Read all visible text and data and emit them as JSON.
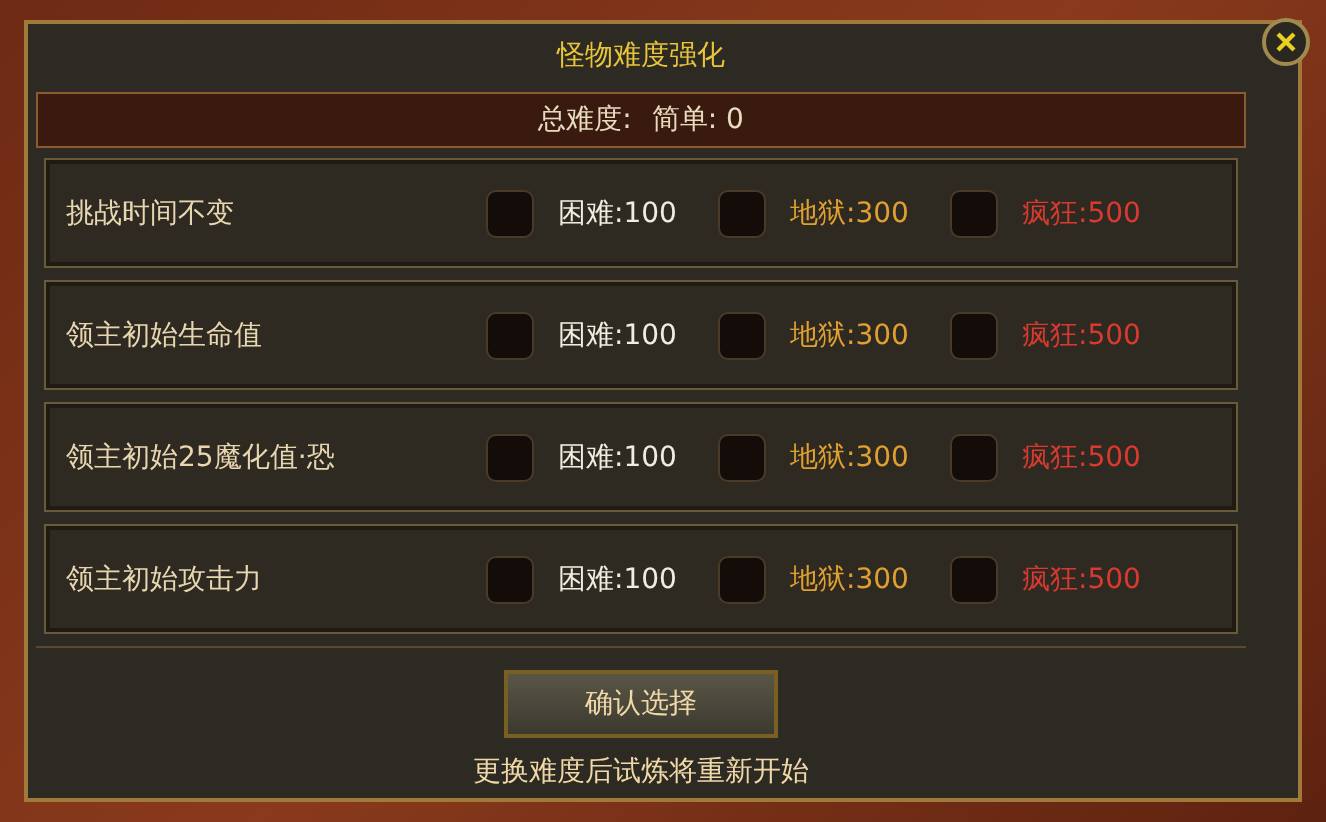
{
  "window": {
    "title": "怪物难度强化"
  },
  "total": {
    "label": "总难度:",
    "value": "简单: 0"
  },
  "rows": [
    {
      "name": "挑战时间不变",
      "options": [
        {
          "kind": "hard",
          "label": "困难:100",
          "checked": false
        },
        {
          "kind": "hell",
          "label": "地狱:300",
          "checked": false
        },
        {
          "kind": "crazy",
          "label": "疯狂:500",
          "checked": false
        }
      ]
    },
    {
      "name": "领主初始生命值",
      "options": [
        {
          "kind": "hard",
          "label": "困难:100",
          "checked": false
        },
        {
          "kind": "hell",
          "label": "地狱:300",
          "checked": false
        },
        {
          "kind": "crazy",
          "label": "疯狂:500",
          "checked": false
        }
      ]
    },
    {
      "name": "领主初始25魔化值·恐",
      "options": [
        {
          "kind": "hard",
          "label": "困难:100",
          "checked": false
        },
        {
          "kind": "hell",
          "label": "地狱:300",
          "checked": false
        },
        {
          "kind": "crazy",
          "label": "疯狂:500",
          "checked": false
        }
      ]
    },
    {
      "name": "领主初始攻击力",
      "options": [
        {
          "kind": "hard",
          "label": "困难:100",
          "checked": false
        },
        {
          "kind": "hell",
          "label": "地狱:300",
          "checked": false
        },
        {
          "kind": "crazy",
          "label": "疯狂:500",
          "checked": false
        }
      ]
    }
  ],
  "confirm_button": "确认选择",
  "note": "更换难度后试炼将重新开始"
}
